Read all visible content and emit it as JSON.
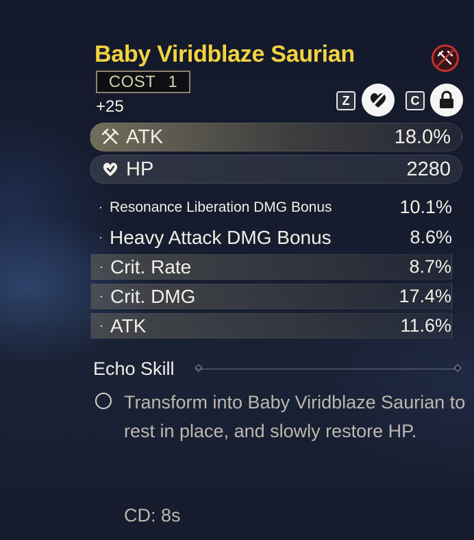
{
  "echo": {
    "name": "Baby Viridblaze Saurian",
    "cost_label": "COST",
    "cost_value": "1",
    "level": "+25"
  },
  "controls": {
    "key_z": "Z",
    "key_c": "C",
    "discard_icon": "heart-slash-icon",
    "lock_icon": "lock-icon",
    "disable_icon": "crossed-swords-disabled-icon"
  },
  "main_stats": [
    {
      "label": "ATK",
      "value": "18.0%",
      "icon": "crossed-swords-icon"
    },
    {
      "label": "HP",
      "value": "2280",
      "icon": "heart-icon"
    }
  ],
  "sub_stats": [
    {
      "bullet": "·",
      "label": "Resonance Liberation DMG Bonus",
      "value": "10.1%"
    },
    {
      "bullet": "·",
      "label": "Heavy Attack DMG Bonus",
      "value": "8.6%"
    },
    {
      "bullet": "·",
      "label": "Crit. Rate",
      "value": "8.7%"
    },
    {
      "bullet": "·",
      "label": "Crit. DMG",
      "value": "17.4%"
    },
    {
      "bullet": "·",
      "label": "ATK",
      "value": "11.6%"
    }
  ],
  "skill": {
    "section_title": "Echo Skill",
    "description": "Transform into Baby Viridblaze Saurian to rest in place, and slowly restore HP.",
    "cooldown": "CD: 8s"
  },
  "colors": {
    "title": "#f2d33f",
    "danger": "#c7302f",
    "text": "#f2efe6",
    "muted_text": "#bdb8ae"
  }
}
